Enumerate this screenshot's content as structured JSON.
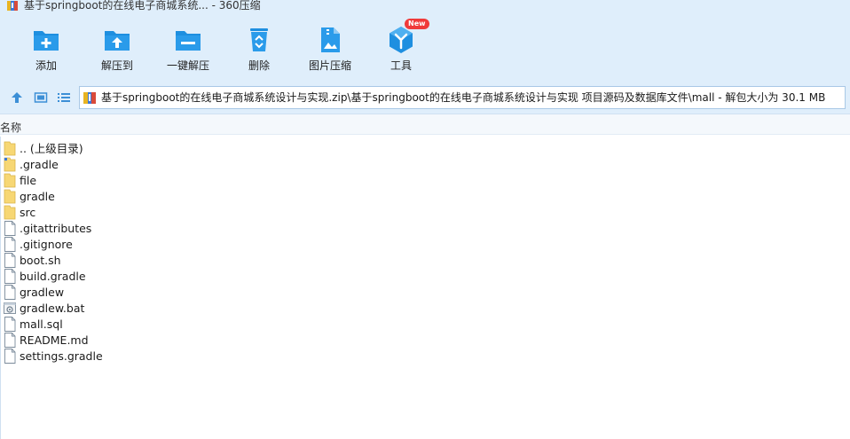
{
  "window": {
    "title": "基于springboot的在线电子商城系统... - 360压缩"
  },
  "toolbar": {
    "items": [
      {
        "label": "添加",
        "icon": "add-folder-icon"
      },
      {
        "label": "解压到",
        "icon": "extract-to-icon"
      },
      {
        "label": "一键解压",
        "icon": "one-click-extract-icon"
      },
      {
        "label": "删除",
        "icon": "recycle-bin-icon"
      },
      {
        "label": "图片压缩",
        "icon": "image-compress-icon"
      },
      {
        "label": "工具",
        "icon": "tools-cube-icon",
        "badge": "New"
      }
    ]
  },
  "address": {
    "path": "基于springboot的在线电子商城系统设计与实现.zip\\基于springboot的在线电子商城系统设计与实现 项目源码及数据库文件\\mall - 解包大小为 30.1 MB"
  },
  "columns": {
    "name": "名称"
  },
  "files": [
    {
      "name": ".. (上级目录)",
      "type": "folder"
    },
    {
      "name": ".gradle",
      "type": "folder"
    },
    {
      "name": "file",
      "type": "folder"
    },
    {
      "name": "gradle",
      "type": "folder"
    },
    {
      "name": "src",
      "type": "folder"
    },
    {
      "name": ".gitattributes",
      "type": "file"
    },
    {
      "name": ".gitignore",
      "type": "file"
    },
    {
      "name": "boot.sh",
      "type": "file"
    },
    {
      "name": "build.gradle",
      "type": "file"
    },
    {
      "name": "gradlew",
      "type": "file"
    },
    {
      "name": "gradlew.bat",
      "type": "gear-file"
    },
    {
      "name": "mall.sql",
      "type": "file"
    },
    {
      "name": "README.md",
      "type": "file"
    },
    {
      "name": "settings.gradle",
      "type": "file"
    }
  ],
  "colors": {
    "toolbar_bg": "#dfeefb",
    "icon_blue": "#1e8fe0",
    "folder_yellow": "#f7d774",
    "badge_red": "#f03a3a"
  }
}
